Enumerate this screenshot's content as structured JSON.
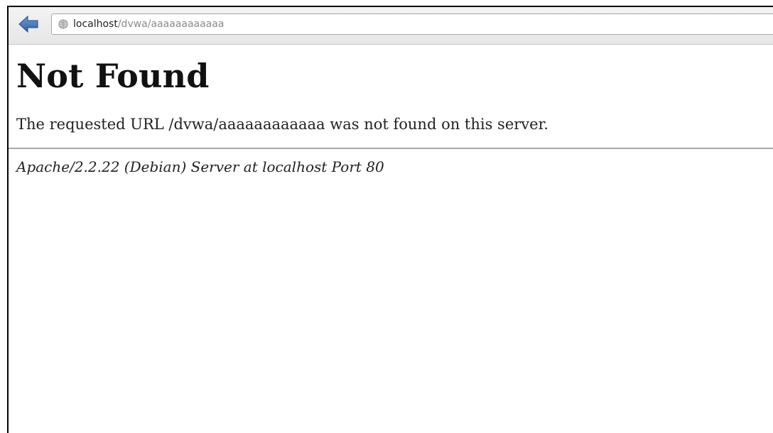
{
  "browser": {
    "url_host": "localhost",
    "url_path": "/dvwa/aaaaaaaaaaaa",
    "back_icon": "back-arrow-icon",
    "site_icon": "globe-icon",
    "accent_color": "#3a6fb0"
  },
  "page": {
    "title": "Not Found",
    "message": "The requested URL /dvwa/aaaaaaaaaaaa was not found on this server.",
    "server_signature": "Apache/2.2.22 (Debian) Server at localhost Port 80"
  }
}
